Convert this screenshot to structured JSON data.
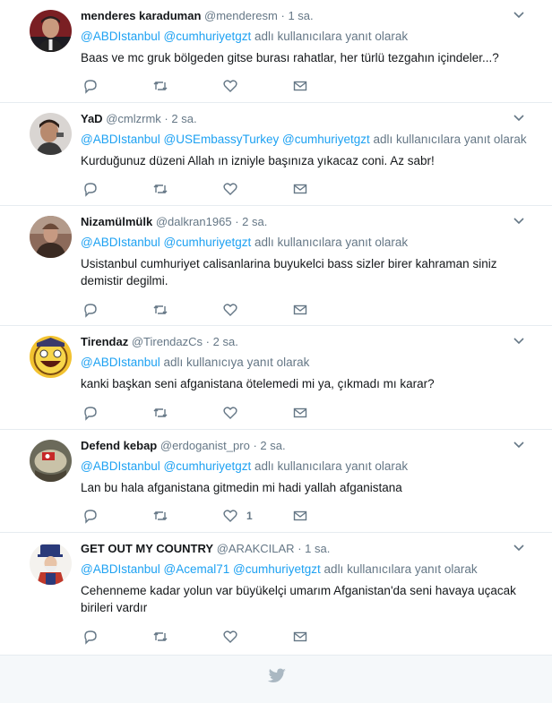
{
  "tweets": [
    {
      "fullname": "menderes karaduman",
      "screen_name": "@menderesm",
      "dot": "·",
      "time": "1 sa.",
      "mentions": [
        "@ABDIstanbul",
        "@cumhuriyetgzt"
      ],
      "reply_suffix": "adlı kullanıcılara yanıt olarak",
      "text": "Baas ve mc gruk bölgeden gitse burası rahatlar, her türlü tezgahın içindeler...?",
      "like_count": ""
    },
    {
      "fullname": "YaD",
      "screen_name": "@cmlzrmk",
      "dot": "·",
      "time": "2 sa.",
      "mentions": [
        "@ABDIstanbul",
        "@USEmbassyTurkey",
        "@cumhuriyetgzt"
      ],
      "reply_suffix": "adlı kullanıcılara yanıt olarak",
      "text": "Kurduğunuz düzeni Allah ın izniyle başınıza yıkacaz coni. Az sabr!",
      "like_count": ""
    },
    {
      "fullname": "Nizamülmülk",
      "screen_name": "@dalkran1965",
      "dot": "·",
      "time": "2 sa.",
      "mentions": [
        "@ABDIstanbul",
        "@cumhuriyetgzt"
      ],
      "reply_suffix": "adlı kullanıcılara yanıt olarak",
      "text": "Usistanbul cumhuriyet calisanlarina buyukelci bass sizler birer kahraman siniz demistir degilmi.",
      "like_count": ""
    },
    {
      "fullname": "Tirendaz",
      "screen_name": "@TirendazCs",
      "dot": "·",
      "time": "2 sa.",
      "mentions": [
        "@ABDIstanbul"
      ],
      "reply_suffix": "adlı kullanıcıya yanıt olarak",
      "text": "kanki başkan seni afganistana ötelemedi mi ya, çıkmadı mı karar?",
      "like_count": ""
    },
    {
      "fullname": "Defend kebap",
      "screen_name": "@erdoganist_pro",
      "dot": "·",
      "time": "2 sa.",
      "mentions": [
        "@ABDIstanbul",
        "@cumhuriyetgzt"
      ],
      "reply_suffix": "adlı kullanıcılara yanıt olarak",
      "text": "Lan bu hala afganistana gitmedin mi hadi yallah afganistana",
      "like_count": "1"
    },
    {
      "fullname": "GET OUT MY COUNTRY",
      "screen_name": "@ARAKCILAR",
      "dot": "·",
      "time": "1 sa.",
      "mentions": [
        "@ABDIstanbul",
        "@Acemal71",
        "@cumhuriyetgzt"
      ],
      "reply_suffix": "adlı kullanıcılara yanıt olarak",
      "text": "Cehenneme kadar yolun var büyükelçi umarım Afganistan'da seni havaya uçacak birileri vardır",
      "like_count": ""
    }
  ],
  "colors": {
    "accent": "#1da1f2",
    "muted": "#657786",
    "divider": "#e6ecf0",
    "footer_bg": "#f5f8fa",
    "bird": "#aab8c2"
  },
  "icons": {
    "reply": "reply-icon",
    "retweet": "retweet-icon",
    "like": "heart-icon",
    "dm": "envelope-icon",
    "caret": "chevron-down-icon",
    "footer": "twitter-bird-icon"
  }
}
